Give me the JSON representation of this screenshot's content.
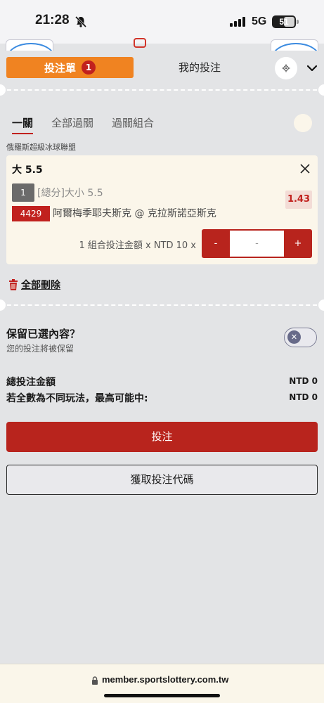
{
  "status_bar": {
    "time": "21:28",
    "network": "5G",
    "battery": "51"
  },
  "header": {
    "slip_tab": "投注單",
    "slip_count": "1",
    "my_bets_tab": "我的投注"
  },
  "subtabs": [
    "一關",
    "全部過關",
    "過關組合"
  ],
  "league": "俄羅斯超級冰球聯盟",
  "bet": {
    "title": "大 5.5",
    "leg_number": "1",
    "market": "[總分]大小 5.5",
    "odds": "1.43",
    "match_code": "4429",
    "match_name": "阿爾梅季耶夫斯克 @ 克拉斯諾亞斯克",
    "stake_label": "1 組合投注金額 x NTD 10 x",
    "stake_minus": "-",
    "stake_value": "-",
    "stake_plus": "+"
  },
  "delete_all": "全部刪除",
  "keep": {
    "title": "保留已選內容？",
    "subtitle": "您的投注將被保留"
  },
  "totals": {
    "total_label": "總投注金額",
    "total_value": "NTD 0",
    "maxwin_label": "若全數為不同玩法，最高可能中:",
    "maxwin_value": "NTD 0"
  },
  "actions": {
    "place_bet": "投注",
    "get_code": "獲取投注代碼"
  },
  "browser": {
    "url": "member.sportslottery.com.tw"
  },
  "colors": {
    "accent_orange": "#f08321",
    "brand_red": "#b8241d",
    "card_bg": "#fbf6ea"
  }
}
